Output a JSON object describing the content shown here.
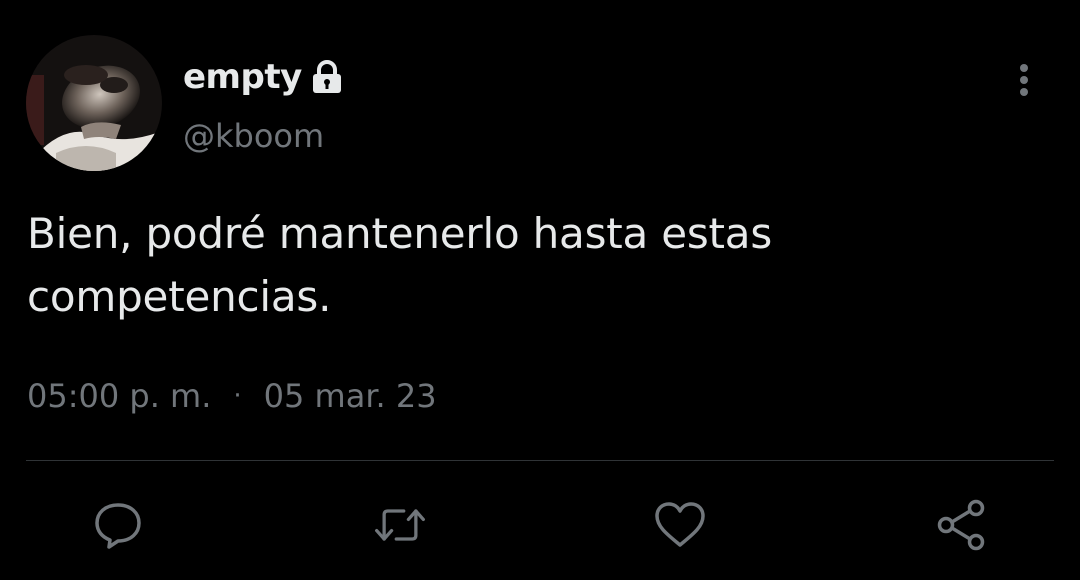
{
  "tweet": {
    "display_name": "empty",
    "handle": "@kboom",
    "text_line1": "Bien, podré mantenerlo hasta estas",
    "text_line2": "competencias.",
    "time": "05:00 p. m.",
    "separator": "·",
    "date": "05 mar. 23",
    "protected_icon": "lock-icon",
    "more_icon": "more-vertical-icon"
  },
  "actions": [
    {
      "name": "reply",
      "icon": "comment-icon"
    },
    {
      "name": "retweet",
      "icon": "retweet-icon"
    },
    {
      "name": "like",
      "icon": "heart-icon"
    },
    {
      "name": "share",
      "icon": "share-icon"
    }
  ],
  "colors": {
    "background": "#000000",
    "primary_text": "#e7e9ea",
    "secondary_text": "#71767b",
    "divider": "#2f3336"
  }
}
